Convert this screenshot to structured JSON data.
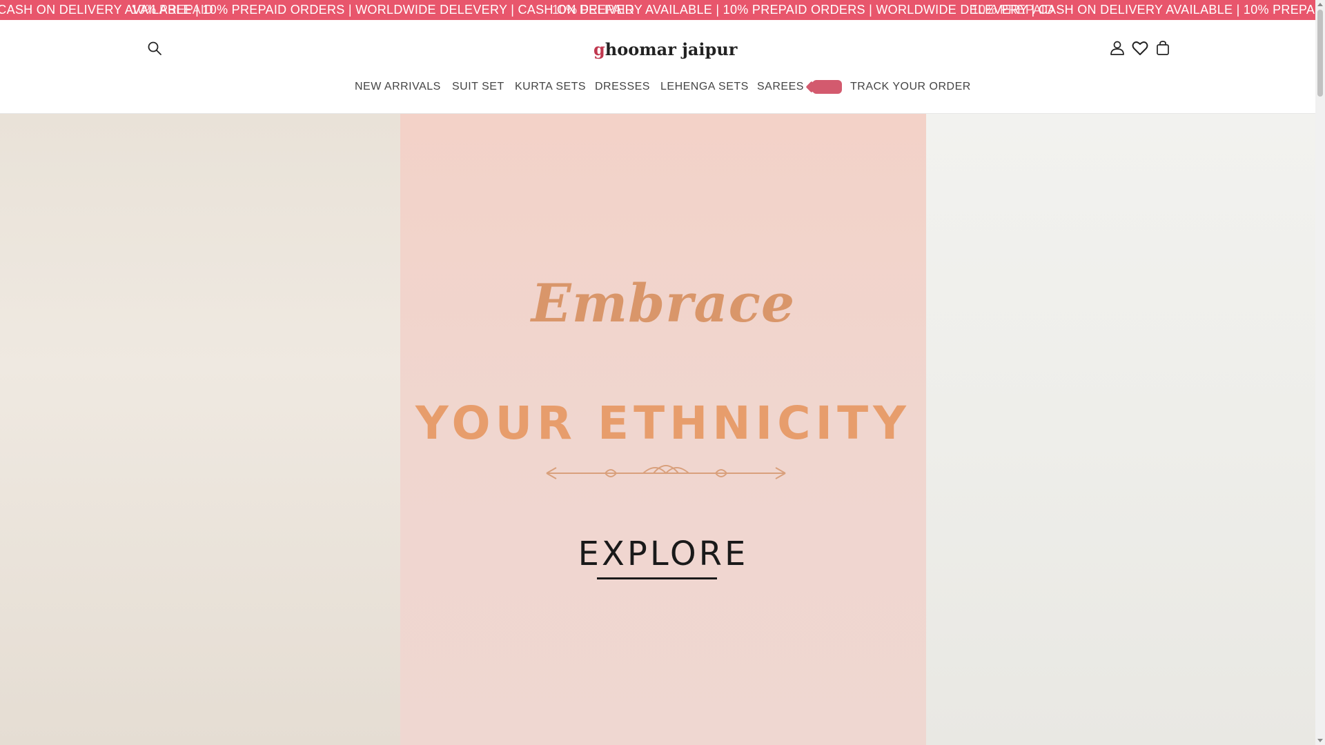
{
  "announcement": {
    "text": "| CASH ON DELIVERY AVAILABLE | 10% PREPAID ORDERS | WORLDWIDE DELEVERY | CASH ON DELIVERY AVAILABLE | 10% PREPAID ORDERS | WORLDWIDE DELEVERY | CASH ON DELIVERY AVAILABLE | 10% PREPAID ORDERS | WORLDWIDE DELEVERY | CASH ON DELIVERY AVAILABLE",
    "overlay_1": "10% PREPAID",
    "overlay_2": "10% PREPAID",
    "overlay_3": "10% PREPAID",
    "color": "#e8566c"
  },
  "header": {
    "logo_first_letter": "g",
    "logo_rest": "hoomar jaipur",
    "icons": {
      "search": "search-icon",
      "account": "user-icon",
      "wishlist": "heart-icon",
      "cart": "cart-icon"
    }
  },
  "nav": {
    "items": [
      {
        "label": "NEW ARRIVALS"
      },
      {
        "label": "SUIT SET"
      },
      {
        "label": "KURTA SETS"
      },
      {
        "label": "DRESSES"
      },
      {
        "label": "LEHENGA SETS"
      },
      {
        "label": "SAREES"
      },
      {
        "label": "TRACK YOUR ORDER"
      }
    ],
    "tag_color": "#d35a6e"
  },
  "hero": {
    "headline_script": "Embrace",
    "headline_main": "YOUR ETHNICITY",
    "cta": "EXPLORE",
    "accent_color": "#e79d6c"
  }
}
